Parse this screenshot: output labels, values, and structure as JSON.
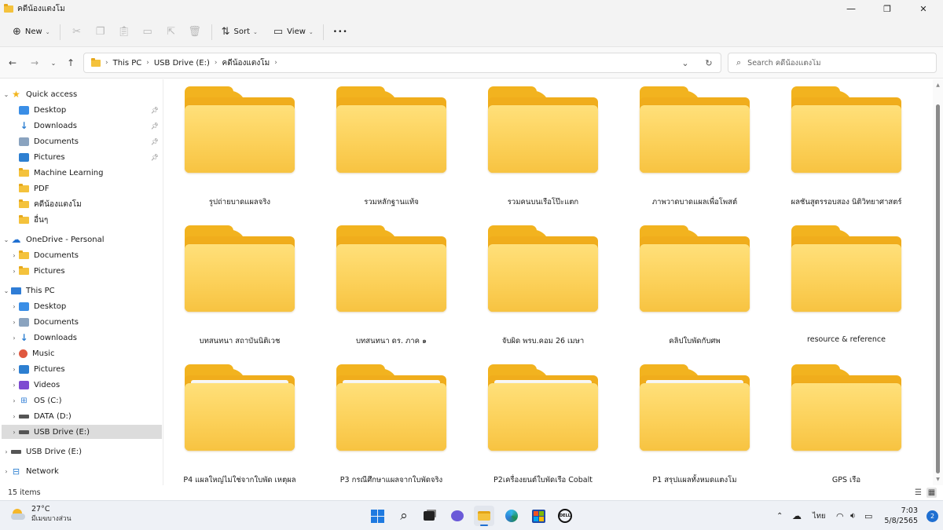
{
  "window": {
    "title": "คดีน้องแตงโม",
    "minimize": "—",
    "maximize": "❐",
    "close": "✕"
  },
  "toolbar": {
    "new_label": "New",
    "sort_label": "Sort",
    "view_label": "View",
    "more_label": "•••",
    "icons": [
      "cut-icon",
      "copy-icon",
      "paste-icon",
      "rename-icon",
      "share-icon",
      "delete-icon"
    ]
  },
  "address_bar": {
    "crumbs": [
      "This PC",
      "USB Drive (E:)",
      "คดีน้องแตงโม"
    ],
    "search_placeholder": "Search คดีน้องแตงโม"
  },
  "sidebar": {
    "quick_access": {
      "label": "Quick access",
      "items": [
        {
          "label": "Desktop",
          "pinned": true
        },
        {
          "label": "Downloads",
          "pinned": true
        },
        {
          "label": "Documents",
          "pinned": true
        },
        {
          "label": "Pictures",
          "pinned": true
        },
        {
          "label": "Machine Learning",
          "pinned": false
        },
        {
          "label": "PDF",
          "pinned": false
        },
        {
          "label": "คดีน้องแตงโม",
          "pinned": false
        },
        {
          "label": "อื่นๆ",
          "pinned": false
        }
      ]
    },
    "onedrive": {
      "label": "OneDrive - Personal",
      "items": [
        {
          "label": "Documents"
        },
        {
          "label": "Pictures"
        }
      ]
    },
    "this_pc": {
      "label": "This PC",
      "items": [
        {
          "label": "Desktop"
        },
        {
          "label": "Documents"
        },
        {
          "label": "Downloads"
        },
        {
          "label": "Music"
        },
        {
          "label": "Pictures"
        },
        {
          "label": "Videos"
        },
        {
          "label": "OS (C:)"
        },
        {
          "label": "DATA (D:)"
        },
        {
          "label": "USB Drive (E:)",
          "selected": true
        }
      ]
    },
    "usb_root": {
      "label": "USB Drive (E:)"
    },
    "network": {
      "label": "Network"
    }
  },
  "folders": [
    {
      "name": "รูปถ่ายบาดแผลจริง",
      "has_paper": false
    },
    {
      "name": "รวมหลักฐานแท้จ",
      "has_paper": false
    },
    {
      "name": "รวมคนบนเรือโป๊ะแตก",
      "has_paper": false
    },
    {
      "name": "ภาพวาดบาดแผลเพื่อโพสต์",
      "has_paper": false
    },
    {
      "name": "ผลชันสูตรรอบสอง นิติวิทยาศาสตร์",
      "has_paper": false
    },
    {
      "name": "บทสนทนา สถาบันนิติเวช",
      "has_paper": false
    },
    {
      "name": "บทสนทนา ดร. ภาค ๑",
      "has_paper": false
    },
    {
      "name": "จับผิด พรบ.คอม 26 เมษา",
      "has_paper": false
    },
    {
      "name": "คลิปใบพัดกับศพ",
      "has_paper": false
    },
    {
      "name": "resource & reference",
      "has_paper": false
    },
    {
      "name": "P4 แผลใหญ่ไม่ใช่จากใบพัด เหตุผล",
      "has_paper": true
    },
    {
      "name": "P3 กรณีศึกษาแผลจากใบพัดจริง",
      "has_paper": true
    },
    {
      "name": "P2เครื่องยนต์ใบพัดเรือ Cobalt",
      "has_paper": true
    },
    {
      "name": "P1 สรุปแผลทั้งหมดแตงโม",
      "has_paper": true
    },
    {
      "name": "GPS เรือ",
      "has_paper": false
    }
  ],
  "status": {
    "item_count": "15 items"
  },
  "taskbar": {
    "weather": {
      "temp": "27°C",
      "condition": "มีเมฆบางส่วน"
    },
    "language": "ไทย",
    "time": "7:03",
    "date": "5/8/2565",
    "notifications": "2",
    "apps": [
      "windows-start",
      "search",
      "task-view",
      "teams-chat",
      "file-explorer",
      "edge",
      "store",
      "dell"
    ]
  },
  "colors": {
    "folder_front": "#fcd15a",
    "folder_back": "#f0ad1c",
    "accent": "#1f6fd1",
    "selected_bg": "#dcdcdc"
  }
}
